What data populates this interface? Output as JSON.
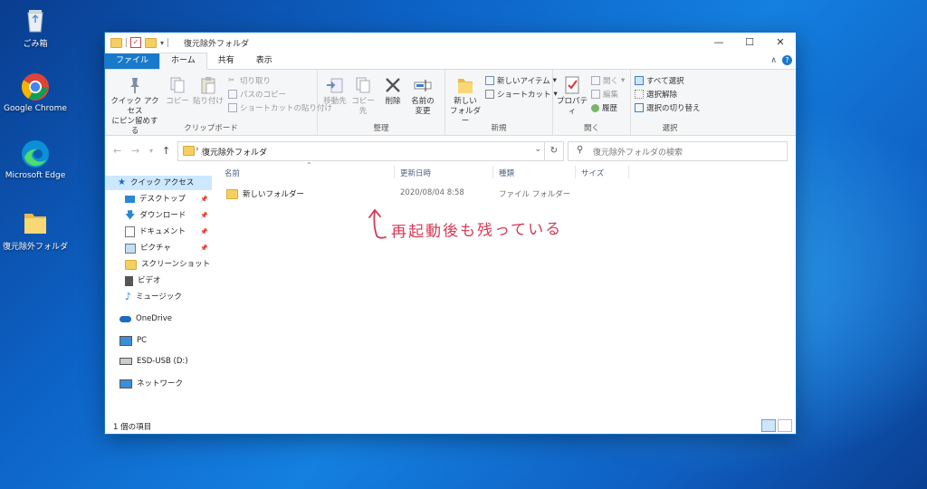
{
  "desktop": {
    "icons": [
      {
        "label": "ごみ箱",
        "icon": "recycle-bin-icon"
      },
      {
        "label": "Google Chrome",
        "icon": "chrome-icon"
      },
      {
        "label": "Microsoft Edge",
        "icon": "edge-icon"
      },
      {
        "label": "復元除外フォルダ",
        "icon": "folder-icon"
      }
    ]
  },
  "window": {
    "title": "復元除外フォルダ",
    "controls": {
      "minimize": "—",
      "maximize": "☐",
      "close": "✕"
    }
  },
  "ribbon": {
    "tabs": [
      "ファイル",
      "ホーム",
      "共有",
      "表示"
    ],
    "active_tab": "ホーム",
    "clipboard": {
      "pin_quick": "クイック アクセス\nにピン留めする",
      "copy": "コピー",
      "paste": "貼り付け",
      "cut": "切り取り",
      "copy_path": "パスのコピー",
      "paste_shortcut": "ショートカットの貼り付け",
      "label": "クリップボード"
    },
    "organize": {
      "move_to": "移動先",
      "copy_to": "コピー先",
      "delete": "削除",
      "rename": "名前の\n変更",
      "label": "整理"
    },
    "new": {
      "new_folder": "新しい\nフォルダー",
      "new_item": "新しいアイテム",
      "shortcut": "ショートカット",
      "label": "新規"
    },
    "open": {
      "properties": "プロパティ",
      "open": "開く",
      "edit": "編集",
      "history": "履歴",
      "label": "開く"
    },
    "select": {
      "select_all": "すべて選択",
      "select_none": "選択解除",
      "invert": "選択の切り替え",
      "label": "選択"
    }
  },
  "address": {
    "path": "復元除外フォルダ",
    "search_placeholder": "復元除外フォルダの検索"
  },
  "nav": {
    "quick_access": "クイック アクセス",
    "items": [
      {
        "label": "デスクトップ",
        "pinned": true
      },
      {
        "label": "ダウンロード",
        "pinned": true
      },
      {
        "label": "ドキュメント",
        "pinned": true
      },
      {
        "label": "ピクチャ",
        "pinned": true
      },
      {
        "label": "スクリーンショット",
        "pinned": false
      },
      {
        "label": "ビデオ",
        "pinned": false
      },
      {
        "label": "ミュージック",
        "pinned": false
      }
    ],
    "onedrive": "OneDrive",
    "pc": "PC",
    "usb": "ESD-USB (D:)",
    "network": "ネットワーク"
  },
  "content": {
    "columns": {
      "name": "名前",
      "date": "更新日時",
      "type": "種類",
      "size": "サイズ"
    },
    "rows": [
      {
        "name": "新しいフォルダー",
        "date": "2020/08/04 8:58",
        "type": "ファイル フォルダー",
        "size": ""
      }
    ],
    "annotation": "再起動後も残っている"
  },
  "status": {
    "count": "1 個の項目"
  },
  "colors": {
    "accent": "#1979ca",
    "annotation": "#d43a56",
    "selected": "#cce8ff"
  }
}
